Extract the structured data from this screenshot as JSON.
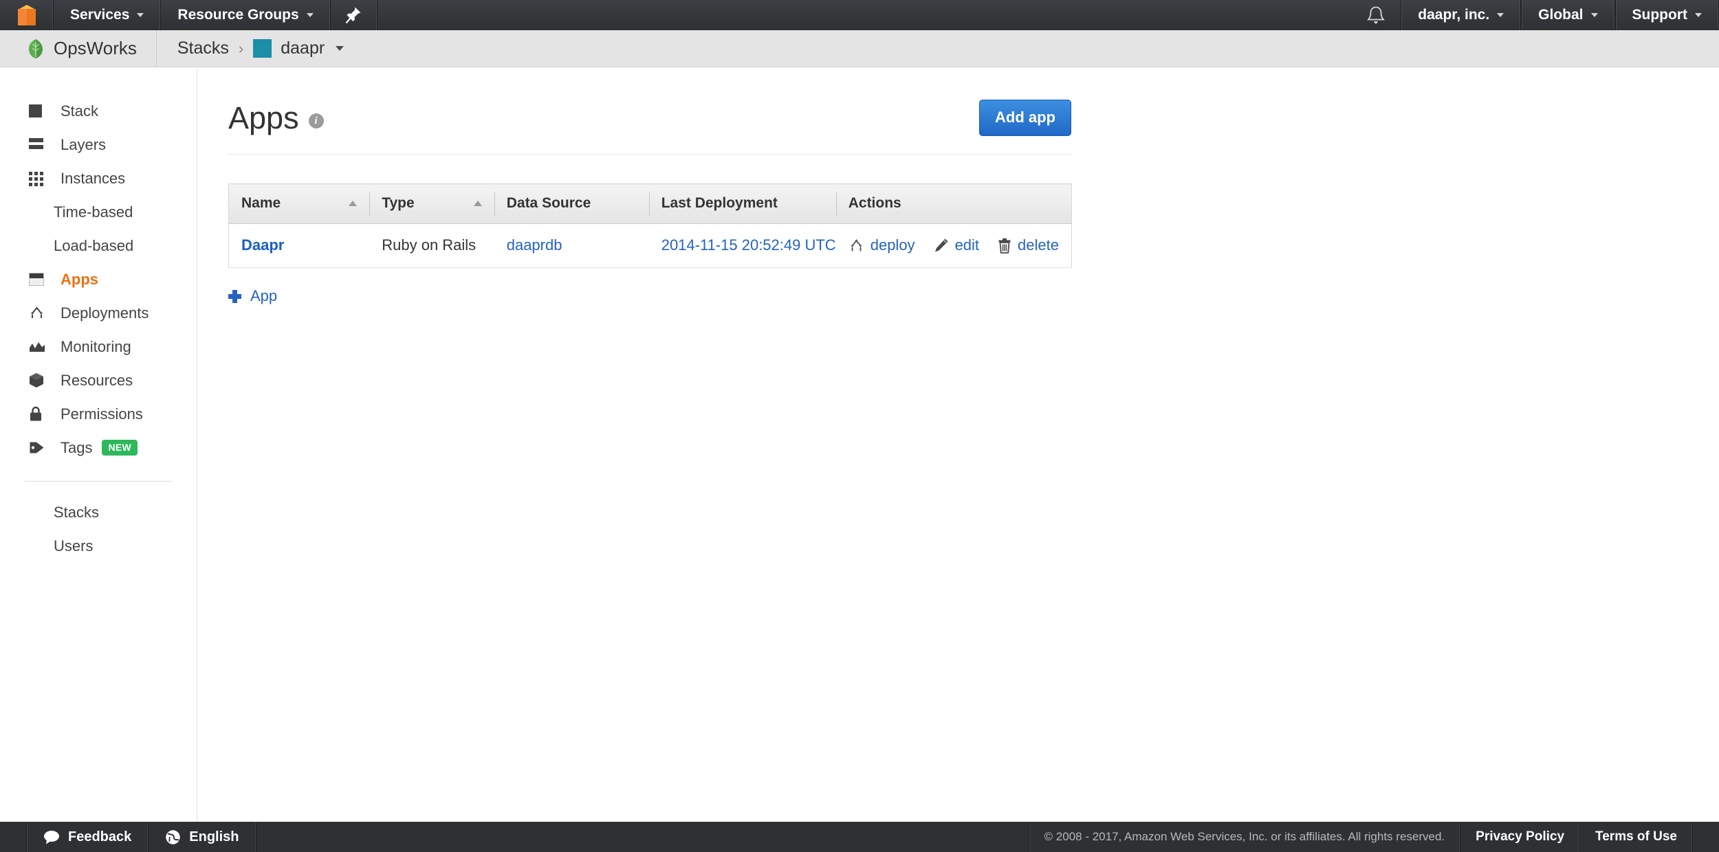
{
  "topnav": {
    "logo_icon": "aws-cube-icon",
    "services_label": "Services",
    "resource_groups_label": "Resource Groups",
    "pin_icon": "pin-icon",
    "bell_icon": "bell-notification-icon",
    "account_label": "daapr, inc.",
    "region_label": "Global",
    "support_label": "Support"
  },
  "breadcrumb": {
    "brand_icon": "opsworks-chef-leaf-icon",
    "brand_label": "OpsWorks",
    "stacks_label": "Stacks",
    "separator": "›",
    "stack_label": "daapr",
    "stack_color": "#1b8fa8"
  },
  "sidebar": {
    "items": [
      {
        "label": "Stack",
        "icon": "stack-icon",
        "active": false,
        "sub": false
      },
      {
        "label": "Layers",
        "icon": "layers-icon",
        "active": false,
        "sub": false
      },
      {
        "label": "Instances",
        "icon": "instances-grid-icon",
        "active": false,
        "sub": false
      },
      {
        "label": "Time-based",
        "icon": "",
        "active": false,
        "sub": true
      },
      {
        "label": "Load-based",
        "icon": "",
        "active": false,
        "sub": true
      },
      {
        "label": "Apps",
        "icon": "apps-window-icon",
        "active": true,
        "sub": false
      },
      {
        "label": "Deployments",
        "icon": "deployments-branch-icon",
        "active": false,
        "sub": false
      },
      {
        "label": "Monitoring",
        "icon": "monitoring-chart-icon",
        "active": false,
        "sub": false
      },
      {
        "label": "Resources",
        "icon": "resources-cube-icon",
        "active": false,
        "sub": false
      },
      {
        "label": "Permissions",
        "icon": "lock-icon",
        "active": false,
        "sub": false
      },
      {
        "label": "Tags",
        "icon": "tag-icon",
        "active": false,
        "sub": false,
        "badge": "NEW"
      }
    ],
    "footer_items": [
      {
        "label": "Stacks"
      },
      {
        "label": "Users"
      }
    ],
    "active_color": "#ec7211",
    "badge_color": "#2eb85c"
  },
  "main": {
    "title": "Apps",
    "info_icon": "info-icon",
    "add_app_label": "Add app",
    "add_app_color": "#2068c7",
    "table": {
      "columns": [
        {
          "label": "Name",
          "sortable": true,
          "sort_icon": "sort-asc-icon"
        },
        {
          "label": "Type",
          "sortable": true,
          "sort_icon": "sort-asc-icon"
        },
        {
          "label": "Data Source",
          "sortable": false
        },
        {
          "label": "Last Deployment",
          "sortable": false
        },
        {
          "label": "Actions",
          "sortable": false
        }
      ],
      "rows": [
        {
          "name": "Daapr",
          "type": "Ruby on Rails",
          "data_source": "daaprdb",
          "last_deployment": "2014-11-15 20:52:49 UTC",
          "actions": [
            {
              "label": "deploy",
              "icon": "deploy-branch-icon"
            },
            {
              "label": "edit",
              "icon": "pencil-edit-icon"
            },
            {
              "label": "delete",
              "icon": "trash-delete-icon"
            }
          ]
        }
      ]
    },
    "add_row_label": "App",
    "add_row_icon": "plus-icon"
  },
  "footer": {
    "feedback_label": "Feedback",
    "feedback_icon": "speech-bubble-icon",
    "language_label": "English",
    "language_icon": "globe-icon",
    "copyright": "© 2008 - 2017, Amazon Web Services, Inc. or its affiliates. All rights reserved.",
    "privacy_label": "Privacy Policy",
    "terms_label": "Terms of Use"
  }
}
